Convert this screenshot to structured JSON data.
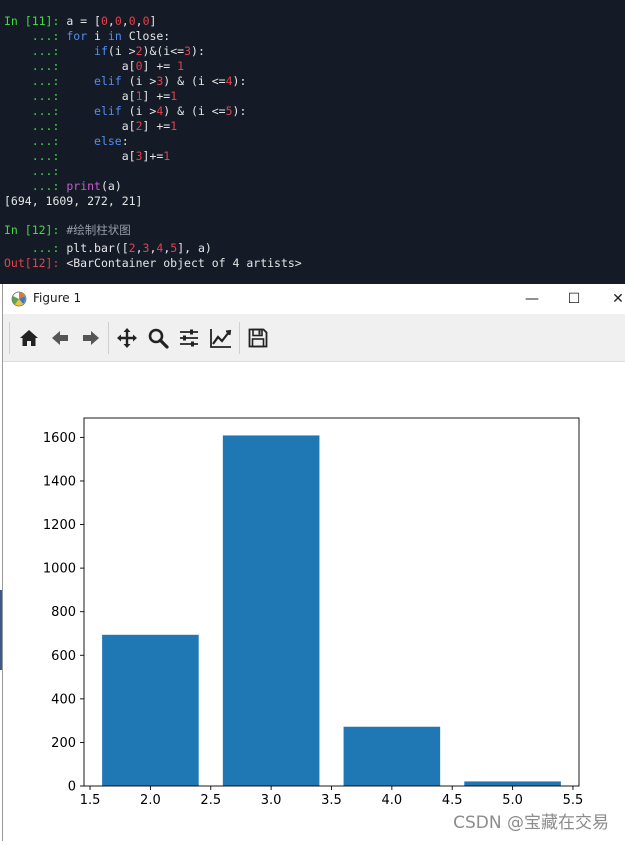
{
  "console": {
    "cell11": {
      "prompt": "In [11]:",
      "cont": "...:",
      "line1": {
        "code_a": "a = [",
        "z1": "0",
        "sep1": ",",
        "z2": "0",
        "sep2": ",",
        "z3": "0",
        "sep3": ",",
        "z4": "0",
        "close": "]"
      },
      "line2": {
        "kw_for": "for",
        "var": " i ",
        "kw_in": "in",
        "rest": " Close:"
      },
      "line3": {
        "kw_if": "if",
        "part1": "(i >",
        "n1": "2",
        "part2": ")&(i<=",
        "n2": "3",
        "part3": "):"
      },
      "line4": {
        "part1": "a[",
        "idx": "0",
        "part2": "] += ",
        "inc": "1"
      },
      "line5": {
        "kw_elif": "elif",
        "part1": " (i >",
        "n1": "3",
        "part2": ") & (i <=",
        "n2": "4",
        "part3": "):"
      },
      "line6": {
        "part1": "a[",
        "idx": "1",
        "part2": "] +=",
        "inc": "1"
      },
      "line7": {
        "kw_elif": "elif",
        "part1": " (i >",
        "n1": "4",
        "part2": ") & (i <=",
        "n2": "5",
        "part3": "):"
      },
      "line8": {
        "part1": "a[",
        "idx": "2",
        "part2": "] +=",
        "inc": "1"
      },
      "line9": {
        "kw_else": "else",
        "colon": ":"
      },
      "line10": {
        "part1": "a[",
        "idx": "3",
        "part2": "]+=",
        "inc": "1"
      },
      "line12": {
        "fn": "print",
        "args": "(a)"
      },
      "output": "[694, 1609, 272, 21]"
    },
    "cell12": {
      "prompt": "In [12]:",
      "comment": "#绘制柱状图",
      "cont": "...:",
      "code": {
        "part1": "plt.bar([",
        "n1": "2",
        "s1": ",",
        "n2": "3",
        "s2": ",",
        "n3": "4",
        "s3": ",",
        "n4": "5",
        "part2": "], a)"
      },
      "out_prompt": "Out[12]:",
      "out_text": "<BarContainer object of 4 artists>"
    }
  },
  "figure_window": {
    "title": "Figure 1",
    "minimize": "—",
    "maximize": "☐",
    "close": "✕",
    "toolbar_icons": [
      "home-icon",
      "back-arrow-icon",
      "forward-arrow-icon",
      "pan-move-icon",
      "zoom-magnifier-icon",
      "configure-subplots-icon",
      "edit-axis-icon",
      "save-floppy-icon"
    ]
  },
  "colors": {
    "console_bg": "#141a26",
    "prompt_green": "#3fdc3f",
    "number_red": "#e0434c",
    "keyword_blue": "#4f8ff0",
    "builtin_purple": "#c75ad1",
    "bar_fill": "#1f77b4"
  },
  "chart_data": {
    "type": "bar",
    "x": [
      2,
      3,
      4,
      5
    ],
    "values": [
      694,
      1609,
      272,
      21
    ],
    "bar_width": 0.8,
    "xlim": [
      1.45,
      5.55
    ],
    "ylim": [
      0,
      1689
    ],
    "xticks": [
      1.5,
      2.0,
      2.5,
      3.0,
      3.5,
      4.0,
      4.5,
      5.0,
      5.5
    ],
    "xtick_labels": [
      "1.5",
      "2.0",
      "2.5",
      "3.0",
      "3.5",
      "4.0",
      "4.5",
      "5.0",
      "5.5"
    ],
    "yticks": [
      0,
      200,
      400,
      600,
      800,
      1000,
      1200,
      1400,
      1600
    ],
    "ytick_labels": [
      "0",
      "200",
      "400",
      "600",
      "800",
      "1000",
      "1200",
      "1400",
      "1600"
    ],
    "grid": false,
    "color": "#1f77b4"
  },
  "watermark": "CSDN @宝藏在交易"
}
